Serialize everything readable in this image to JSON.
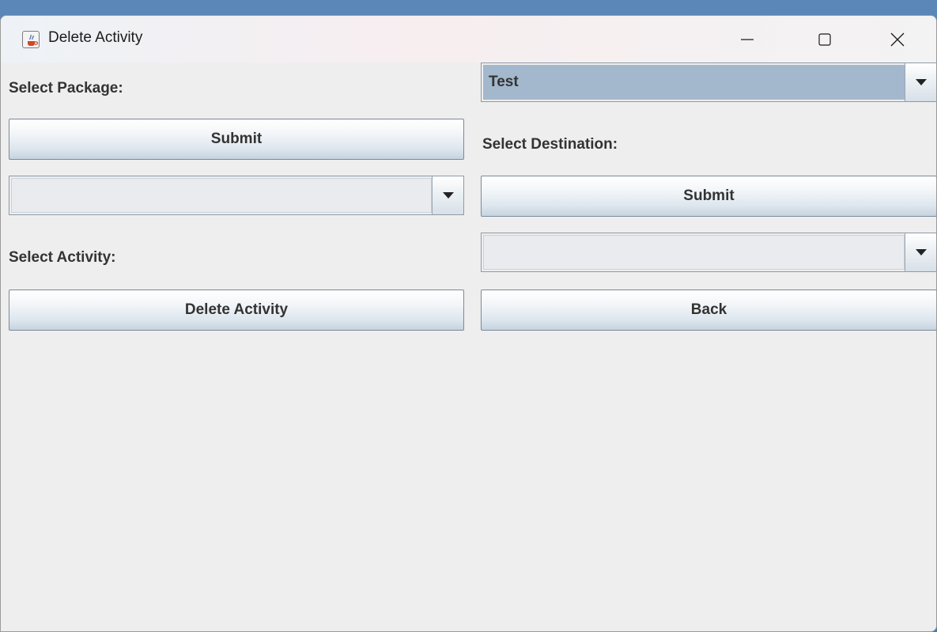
{
  "window": {
    "title": "Delete Activity"
  },
  "labels": {
    "select_package": "Select Package:",
    "select_destination": "Select Destination:",
    "select_activity": "Select Activity:"
  },
  "package_combo": {
    "value": "Test"
  },
  "activity_combo": {
    "value": ""
  },
  "destination_combo": {
    "value": ""
  },
  "buttons": {
    "submit_package": "Submit",
    "submit_destination": "Submit",
    "delete_activity": "Delete Activity",
    "back": "Back"
  },
  "icons": {
    "app": "java-cup-icon",
    "minimize": "minimize-icon",
    "maximize": "maximize-icon",
    "close": "close-icon",
    "dropdown": "chevron-down-icon"
  },
  "colors": {
    "selected_combo": "#a3b8cc",
    "panel_bg": "#eeeeee",
    "label_text": "#333333"
  }
}
